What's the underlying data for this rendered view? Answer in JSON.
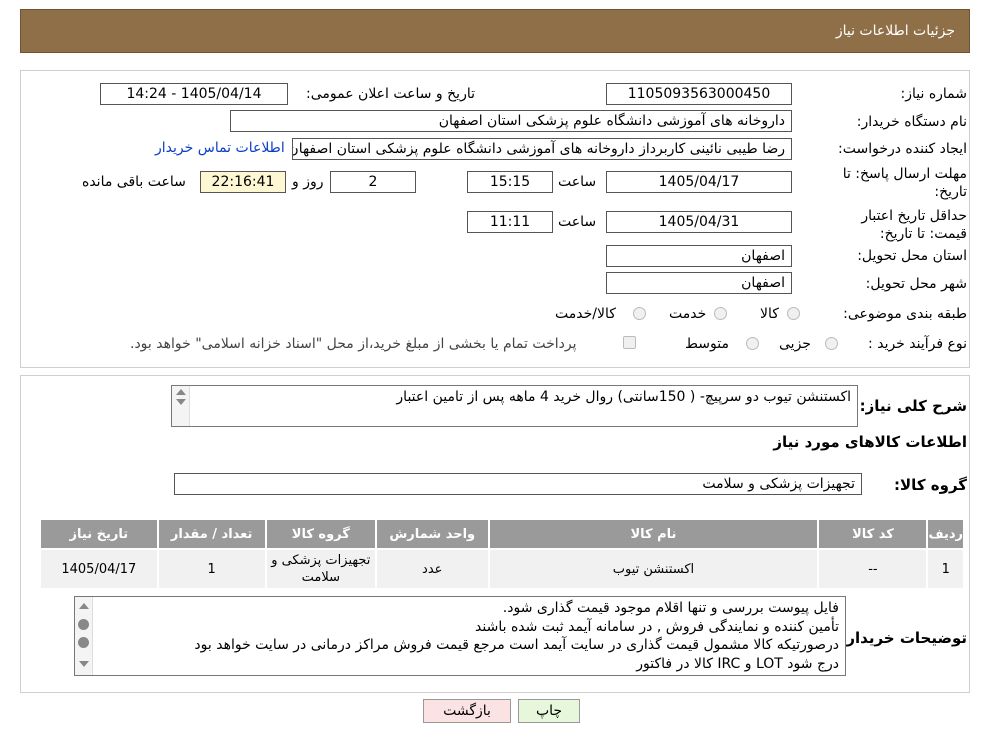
{
  "header": {
    "title": "جزئیات اطلاعات نیاز"
  },
  "fields": {
    "need_number_label": "شماره نیاز:",
    "need_number": "1105093563000450",
    "announce_label": "تاریخ و ساعت اعلان عمومی:",
    "announce_value": "1405/04/14 - 14:24",
    "buyer_org_label": "نام دستگاه خریدار:",
    "buyer_org": "داروخانه های آموزشی دانشگاه علوم پزشکی استان اصفهان",
    "creator_label": "ایجاد کننده درخواست:",
    "creator": "رضا طیبی نائینی کاربرداز داروخانه های آموزشی دانشگاه علوم پزشکی استان اصفهان",
    "contact_link": "اطلاعات تماس خریدار",
    "deadline_label": "مهلت ارسال پاسخ: تا تاریخ:",
    "deadline_date": "1405/04/17",
    "time_label": "ساعت",
    "deadline_time": "15:15",
    "days_value": "2",
    "days_label": "روز و",
    "remaining_time": "22:16:41",
    "remaining_label": "ساعت باقی مانده",
    "validity_label": "حداقل تاریخ اعتبار قیمت: تا تاریخ:",
    "validity_date": "1405/04/31",
    "validity_time": "11:11",
    "province_label": "استان محل تحویل:",
    "province": "اصفهان",
    "city_label": "شهر محل تحویل:",
    "city": "اصفهان",
    "category_label": "طبقه بندی موضوعی:",
    "category_options": [
      "کالا",
      "خدمت",
      "کالا/خدمت"
    ],
    "process_label": "نوع فرآیند خرید :",
    "process_options": [
      "جزیی",
      "متوسط"
    ],
    "payment_note": "پرداخت تمام یا بخشی از مبلغ خرید،از محل \"اسناد خزانه اسلامی\" خواهد بود."
  },
  "description": {
    "label": "شرح کلی نیاز:",
    "text": "اکستنشن تیوب دو سرپیچ- ( 150سانتی)  روال خرید 4 ماهه پس از تامین اعتبار"
  },
  "goods_info": {
    "title": "اطلاعات کالاهای مورد نیاز",
    "group_label": "گروه کالا:",
    "group_value": "تجهیزات پزشکی و سلامت"
  },
  "table": {
    "headers": [
      "ردیف",
      "کد کالا",
      "نام کالا",
      "واحد شمارش",
      "گروه کالا",
      "تعداد / مقدار",
      "تاریخ نیاز"
    ],
    "rows": [
      [
        "1",
        "--",
        "اکستنشن تیوب",
        "عدد",
        "تجهیزات پزشکی و سلامت",
        "1",
        "1405/04/17"
      ]
    ]
  },
  "buyer_notes": {
    "label": "توضیحات خریدار:",
    "lines": [
      "فایل پیوست بررسی و تنها اقلام موجود قیمت گذاری شود.",
      "تأمین کننده و نمایندگی فروش  , در سامانه آیمد ثبت شده باشند",
      "درصورتیکه کالا مشمول قیمت گذاری در سایت آیمد است مرجع قیمت فروش مراکز درمانی در سایت خواهد بود",
      "درج شود LOT و IRC کالا در فاکتور"
    ]
  },
  "buttons": {
    "print": "چاپ",
    "back": "بازگشت"
  },
  "watermark": {
    "text": "AriaTender.neT"
  },
  "colors": {
    "header": "#8f6f47",
    "link": "#0a3dc9",
    "table_header": "#9a9a9a",
    "back_button": "#fbe3e3",
    "print_button": "#e6f7dc"
  }
}
